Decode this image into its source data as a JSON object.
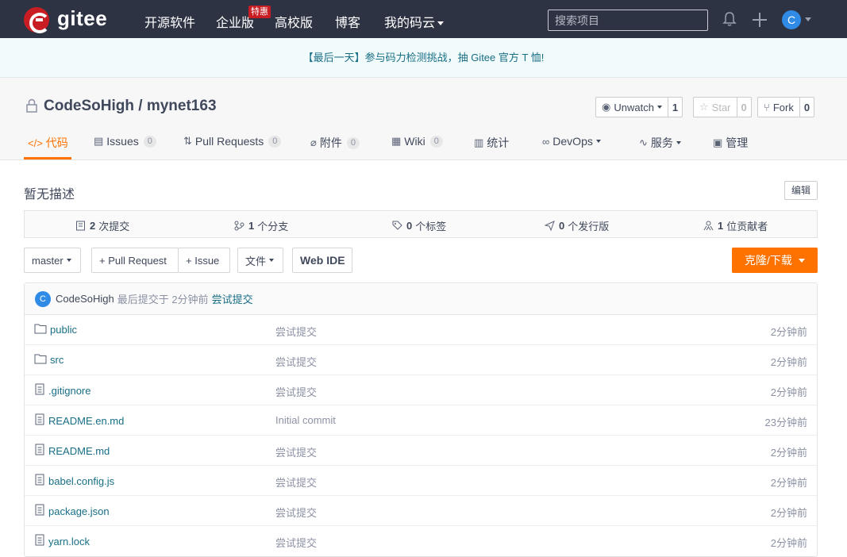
{
  "topbar": {
    "logo_text": "gitee",
    "nav": [
      "开源软件",
      "企业版",
      "高校版",
      "博客",
      "我的码云"
    ],
    "enterprise_badge": "特惠",
    "search_placeholder": "搜索项目",
    "avatar_letter": "C"
  },
  "banner": {
    "text": "【最后一天】参与码力检测挑战，抽 Gitee 官方 T 恤!"
  },
  "project": {
    "owner": "CodeSoHigh",
    "repo": "mynet163",
    "watch": {
      "label": "Unwatch",
      "count": "1"
    },
    "star": {
      "label": "Star",
      "count": "0"
    },
    "fork": {
      "label": "Fork",
      "count": "0"
    }
  },
  "tabs": [
    {
      "label": "代码",
      "icon": "code-icon"
    },
    {
      "label": "Issues",
      "count": "0",
      "icon": "issues-icon"
    },
    {
      "label": "Pull Requests",
      "count": "0",
      "icon": "pull-request-icon"
    },
    {
      "label": "附件",
      "count": "0",
      "icon": "attachment-icon"
    },
    {
      "label": "Wiki",
      "count": "0",
      "icon": "wiki-icon"
    },
    {
      "label": "统计",
      "icon": "stats-icon"
    },
    {
      "label": "DevOps",
      "icon": "devops-icon"
    },
    {
      "label": "服务",
      "icon": "service-icon"
    },
    {
      "label": "管理",
      "icon": "manage-icon"
    }
  ],
  "description": {
    "text": "暂无描述",
    "edit_label": "编辑"
  },
  "stats": {
    "commits": {
      "num": "2",
      "label": "次提交"
    },
    "branches": {
      "num": "1",
      "label": "个分支"
    },
    "tags": {
      "num": "0",
      "label": "个标签"
    },
    "releases": {
      "num": "0",
      "label": "个发行版"
    },
    "contributors": {
      "num": "1",
      "label": "位贡献者"
    }
  },
  "toolbar": {
    "branch": "master",
    "pull_request": "+ Pull Request",
    "issue": "+ Issue",
    "file": "文件",
    "web_ide": "Web IDE",
    "clone": "克隆/下载"
  },
  "last_commit": {
    "avatar_letter": "C",
    "author": "CodeSoHigh",
    "meta": "最后提交于 2分钟前",
    "message": "尝试提交"
  },
  "files": [
    {
      "name": "public",
      "type": "folder",
      "message": "尝试提交",
      "time": "2分钟前"
    },
    {
      "name": "src",
      "type": "folder",
      "message": "尝试提交",
      "time": "2分钟前"
    },
    {
      "name": ".gitignore",
      "type": "file",
      "message": "尝试提交",
      "time": "2分钟前"
    },
    {
      "name": "README.en.md",
      "type": "file",
      "message": "Initial commit",
      "time": "23分钟前"
    },
    {
      "name": "README.md",
      "type": "file",
      "message": "尝试提交",
      "time": "2分钟前"
    },
    {
      "name": "babel.config.js",
      "type": "file",
      "message": "尝试提交",
      "time": "2分钟前"
    },
    {
      "name": "package.json",
      "type": "file",
      "message": "尝试提交",
      "time": "2分钟前"
    },
    {
      "name": "yarn.lock",
      "type": "file",
      "message": "尝试提交",
      "time": "2分钟前"
    }
  ],
  "colors": {
    "brand": "#c71d23",
    "accent": "#fe7300",
    "link": "#186e85",
    "navbar": "#2e3343"
  }
}
